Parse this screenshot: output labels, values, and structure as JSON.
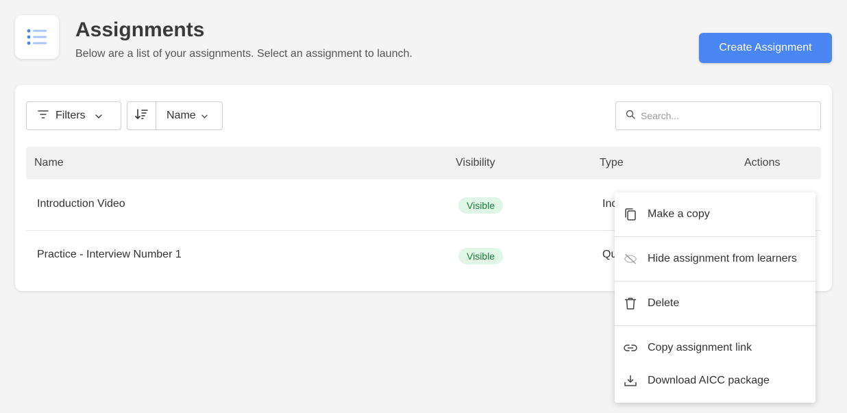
{
  "header": {
    "title": "Assignments",
    "subtitle": "Below are a list of your assignments. Select an assignment to launch.",
    "icon": "list-icon",
    "create_label": "Create Assignment",
    "accent_color": "#4a86f2"
  },
  "toolbar": {
    "filters_label": "Filters",
    "sort_field": "Name",
    "search_placeholder": "Search..."
  },
  "table": {
    "columns": [
      "Name",
      "Visibility",
      "Type",
      "Actions"
    ],
    "rows": [
      {
        "name": "Introduction Video",
        "visibility": "Visible",
        "type": "Inc"
      },
      {
        "name": "Practice - Interview Number 1",
        "visibility": "Visible",
        "type": "Qu"
      }
    ]
  },
  "menu": {
    "items": [
      {
        "label": "Make a copy",
        "icon": "copy-icon"
      },
      {
        "label": "Hide assignment from learners",
        "icon": "eye-off-icon"
      },
      {
        "label": "Delete",
        "icon": "trash-icon"
      },
      {
        "label": "Copy assignment link",
        "icon": "link-icon"
      },
      {
        "label": "Download AICC package",
        "icon": "download-icon"
      }
    ]
  }
}
